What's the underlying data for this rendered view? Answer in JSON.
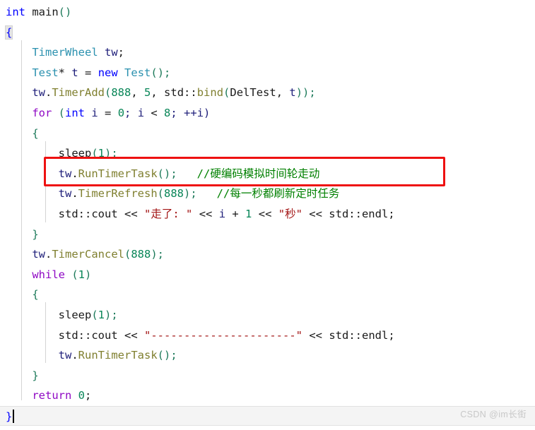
{
  "editor": {
    "language": "C++",
    "background_color": "#ffffff",
    "current_line_highlight": "#f4f4f4",
    "syntax_colors": {
      "keyword": "#0000ff",
      "control_keyword": "#8f08c4",
      "type": "#2b91af",
      "method": "#7f7f2f",
      "number": "#098658",
      "string": "#a31515",
      "comment": "#008000",
      "plain": "#1a1a1a",
      "brace": "#1d7a5a"
    }
  },
  "annotation": {
    "kind": "rectangle-highlight",
    "color": "#ee1111",
    "target_line_text": "tw.RunTimerTask();   //硬编码模拟时间轮走动"
  },
  "watermark": {
    "text": "CSDN @im长街"
  },
  "code": {
    "l1": {
      "a": "int",
      "b": " ",
      "c": "main",
      "d": "()"
    },
    "l2": {
      "a": "{"
    },
    "l3": {
      "a": "TimerWheel",
      "b": " ",
      "c": "tw",
      "d": ";"
    },
    "l4": {
      "a": "Test",
      "b": "*",
      "c": " t ",
      "d": "=",
      "e": " ",
      "f": "new",
      "g": " ",
      "h": "Test",
      "i": "();"
    },
    "l5": {
      "a": "tw",
      "b": ".",
      "c": "TimerAdd",
      "d": "(",
      "e": "888",
      "f": ", ",
      "g": "5",
      "h": ", ",
      "i": "std",
      "j": "::",
      "k": "bind",
      "l": "(",
      "m": "DelTest",
      "n": ", ",
      "o": "t",
      "p": "));"
    },
    "l6": {
      "a": "for",
      "b": " (",
      "c": "int",
      "d": " i ",
      "e": "=",
      "f": " ",
      "g": "0",
      "h": "; i ",
      "i": "<",
      "j": " ",
      "k": "8",
      "l": "; ++i)"
    },
    "l7": {
      "a": "{"
    },
    "l8": {
      "a": "sleep",
      "b": "(",
      "c": "1",
      "d": ");"
    },
    "l9": {
      "a": "tw",
      "b": ".",
      "c": "RunTimerTask",
      "d": "();",
      "e": "   ",
      "f": "//硬编码模拟时间轮走动"
    },
    "l10": {
      "a": "tw",
      "b": ".",
      "c": "TimerRefresh",
      "d": "(",
      "e": "888",
      "f": ");",
      "g": "   ",
      "h": "//每一秒都刷新定时任务"
    },
    "l11": {
      "a": "std",
      "b": "::",
      "c": "cout",
      "d": " ",
      "e": "<<",
      "f": " ",
      "g": "\"走了: \"",
      "h": " ",
      "i": "<<",
      "j": " i ",
      "k": "+",
      "l": " ",
      "m": "1",
      "n": " ",
      "o": "<<",
      "p": " ",
      "q": "\"秒\"",
      "r": " ",
      "s": "<<",
      "t": " ",
      "u": "std",
      "v": "::",
      "w": "endl",
      "x": ";"
    },
    "l12": {
      "a": "}"
    },
    "l13": {
      "a": "tw",
      "b": ".",
      "c": "TimerCancel",
      "d": "(",
      "e": "888",
      "f": ");"
    },
    "l14": {
      "a": "while",
      "b": " (",
      "c": "1",
      "d": ")"
    },
    "l15": {
      "a": "{"
    },
    "l16": {
      "a": "sleep",
      "b": "(",
      "c": "1",
      "d": ");"
    },
    "l17": {
      "a": "std",
      "b": "::",
      "c": "cout",
      "d": " ",
      "e": "<<",
      "f": " ",
      "g": "\"----------------------\"",
      "h": " ",
      "i": "<<",
      "j": " ",
      "k": "std",
      "l": "::",
      "m": "endl",
      "n": ";"
    },
    "l18": {
      "a": "tw",
      "b": ".",
      "c": "RunTimerTask",
      "d": "();"
    },
    "l19": {
      "a": "}"
    },
    "l20": {
      "a": "return",
      "b": " ",
      "c": "0",
      "d": ";"
    },
    "l21": {
      "a": "}"
    }
  }
}
